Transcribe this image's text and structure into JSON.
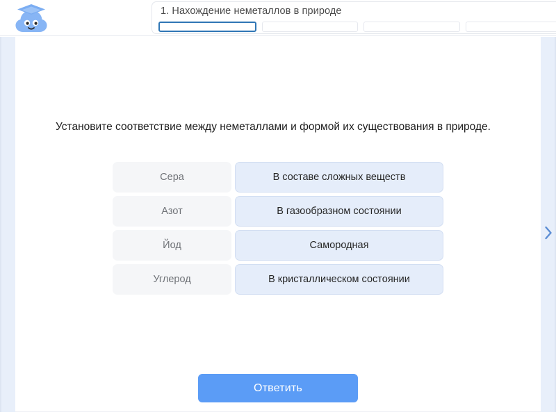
{
  "header": {
    "logo_alt": "cloud-graduate-mascot",
    "progress": {
      "title": "1. Нахождение неметаллов в природе",
      "segments": [
        {
          "index": 1,
          "state": "active"
        },
        {
          "index": 2,
          "state": "inactive"
        },
        {
          "index": 3,
          "state": "inactive"
        },
        {
          "index": 4,
          "state": "inactive"
        }
      ],
      "total_segments": 4,
      "current_segment": 1
    }
  },
  "nav": {
    "next_arrow": "›",
    "next_label": "chevron-right"
  },
  "main": {
    "question": "Установите соответствие между неметаллами и формой их существования в природе.",
    "pairs": [
      {
        "left": "Сера",
        "right": "В составе сложных веществ"
      },
      {
        "left": "Азот",
        "right": "В газообразном состоянии"
      },
      {
        "left": "Йод",
        "right": "Самородная"
      },
      {
        "left": "Углерод",
        "right": "В кристаллическом состоянии"
      }
    ],
    "submit_label": "Ответить"
  },
  "colors": {
    "accent_blue": "#5b9cf6",
    "rail_blue": "#e8effa",
    "card_left_bg": "#f5f6f8",
    "card_right_bg": "#e5edfa",
    "card_right_border": "#d2def2",
    "progress_active_border": "#2f76b5",
    "text_dark": "#1d1d1d",
    "text_muted": "#6f7277"
  }
}
